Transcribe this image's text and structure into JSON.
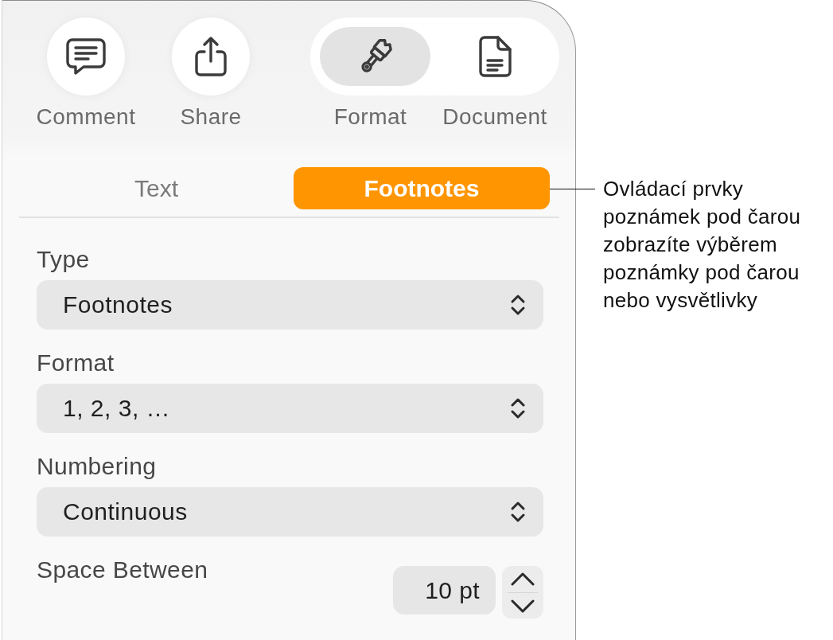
{
  "toolbar": {
    "buttons": [
      {
        "kind": "comment",
        "label": "Comment"
      },
      {
        "kind": "share",
        "label": "Share"
      }
    ],
    "mode_switch": [
      {
        "kind": "format",
        "label": "Format",
        "selected": true
      },
      {
        "kind": "document",
        "label": "Document",
        "selected": false
      }
    ]
  },
  "tabs": [
    {
      "label": "Text",
      "selected": false
    },
    {
      "label": "Footnotes",
      "selected": true
    }
  ],
  "fields": [
    {
      "kind": "popup",
      "label": "Type",
      "value": "Footnotes"
    },
    {
      "kind": "popup",
      "label": "Format",
      "value": "1, 2, 3, …"
    },
    {
      "kind": "popup",
      "label": "Numbering",
      "value": "Continuous"
    },
    {
      "kind": "stepper",
      "label": "Space Between",
      "value": "10 pt"
    }
  ],
  "callout": {
    "text": "Ovládací prvky\npoznámek pod čarou\nzobrazíte výběrem\npoznámky pod čarou\nnebo vysvětlivky"
  }
}
